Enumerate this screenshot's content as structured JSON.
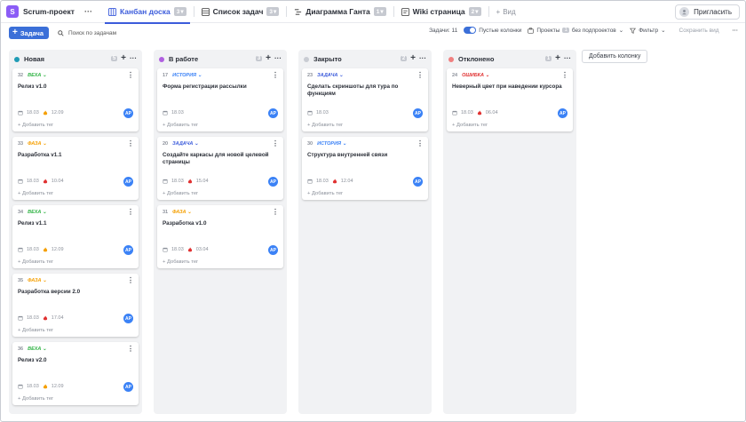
{
  "header": {
    "project_logo": "S",
    "project_name": "Scrum-проект",
    "more": "···",
    "tabs": [
      {
        "label": "Канбан доска",
        "count": "3",
        "icon": "kanban-icon"
      },
      {
        "label": "Список задач",
        "count": "3",
        "icon": "list-icon"
      },
      {
        "label": "Диаграмма Ганта",
        "count": "1",
        "icon": "gantt-icon"
      },
      {
        "label": "Wiki страница",
        "count": "2",
        "icon": "wiki-icon"
      }
    ],
    "add_view": "Вид",
    "invite": "Пригласить"
  },
  "toolbar": {
    "add_task": "Задача",
    "search_placeholder": "Поиск по задачам",
    "tasks_label": "Задачи: 11",
    "empty_columns": "Пустые колонки",
    "projects_label": "Проекты",
    "projects_count": "1",
    "subprojects": "без подпроектов",
    "filter": "Фильтр",
    "save_view": "Сохранить вид",
    "more": "···"
  },
  "colors": {
    "accent": "#3b6fd8",
    "new": "#1f9bb5",
    "in_progress": "#b060e0",
    "closed": "#c9ccd3",
    "rejected": "#f08080",
    "veha": "#2fb344",
    "faza": "#f59f00",
    "istoriya": "#3b82f6",
    "zadacha": "#3b5bdb",
    "oshibka": "#e03131"
  },
  "add_column": "Добавить колонку",
  "columns": [
    {
      "name": "Новая",
      "count": "5",
      "dot": "#1f9bb5",
      "cards": [
        {
          "id": "32",
          "type": "ВЕХА",
          "type_color": "#2fb344",
          "title": "Релиз v1.0",
          "created": "18.03",
          "due": "12.09",
          "fire": "#f59f00",
          "avatar": "АР",
          "add_tag": "+ Добавить тег"
        },
        {
          "id": "33",
          "type": "ФАЗА",
          "type_color": "#f59f00",
          "title": "Разработка v1.1",
          "created": "18.03",
          "due": "10.04",
          "fire": "#e03131",
          "avatar": "АР",
          "add_tag": "+ Добавить тег"
        },
        {
          "id": "34",
          "type": "ВЕХА",
          "type_color": "#2fb344",
          "title": "Релиз v1.1",
          "created": "18.03",
          "due": "12.09",
          "fire": "#f59f00",
          "avatar": "АР",
          "add_tag": "+ Добавить тег"
        },
        {
          "id": "35",
          "type": "ФАЗА",
          "type_color": "#f59f00",
          "title": "Разработка версии 2.0",
          "created": "18.03",
          "due": "17.04",
          "fire": "#e03131",
          "avatar": "АР",
          "add_tag": "+ Добавить тег"
        },
        {
          "id": "36",
          "type": "ВЕХА",
          "type_color": "#2fb344",
          "title": "Релиз v2.0",
          "created": "18.03",
          "due": "12.09",
          "fire": "#f59f00",
          "avatar": "АР",
          "add_tag": "+ Добавить тег"
        }
      ]
    },
    {
      "name": "В работе",
      "count": "3",
      "dot": "#b060e0",
      "cards": [
        {
          "id": "17",
          "type": "ИСТОРИЯ",
          "type_color": "#3b82f6",
          "title": "Форма регистрации рассылки",
          "created": "18.03",
          "due": "",
          "fire": "",
          "avatar": "АР",
          "add_tag": "+ Добавить тег"
        },
        {
          "id": "20",
          "type": "ЗАДАЧА",
          "type_color": "#3b5bdb",
          "title": "Создайте каркасы для новой целевой страницы",
          "created": "18.03",
          "due": "15.04",
          "fire": "#e03131",
          "avatar": "АР",
          "add_tag": "+ Добавить тег"
        },
        {
          "id": "31",
          "type": "ФАЗА",
          "type_color": "#f59f00",
          "title": "Разработка v1.0",
          "created": "18.03",
          "due": "03.04",
          "fire": "#e03131",
          "avatar": "АР",
          "add_tag": "+ Добавить тег"
        }
      ]
    },
    {
      "name": "Закрыто",
      "count": "2",
      "dot": "#c9ccd3",
      "cards": [
        {
          "id": "23",
          "type": "ЗАДАЧА",
          "type_color": "#3b5bdb",
          "title": "Сделать скриншоты для тура по функциям",
          "created": "18.03",
          "due": "",
          "fire": "",
          "avatar": "АР",
          "add_tag": "+ Добавить тег"
        },
        {
          "id": "30",
          "type": "ИСТОРИЯ",
          "type_color": "#3b82f6",
          "title": "Структура внутренней связи",
          "created": "18.03",
          "due": "12.04",
          "fire": "#e03131",
          "avatar": "АР",
          "add_tag": "+ Добавить тег"
        }
      ]
    },
    {
      "name": "Отклонено",
      "count": "1",
      "dot": "#f08080",
      "cards": [
        {
          "id": "24",
          "type": "ОШИБКА",
          "type_color": "#e03131",
          "title": "Неверный цвет при наведении курсора",
          "created": "18.03",
          "due": "06.04",
          "fire": "#e03131",
          "avatar": "АР",
          "add_tag": "+ Добавить тег"
        }
      ]
    }
  ]
}
